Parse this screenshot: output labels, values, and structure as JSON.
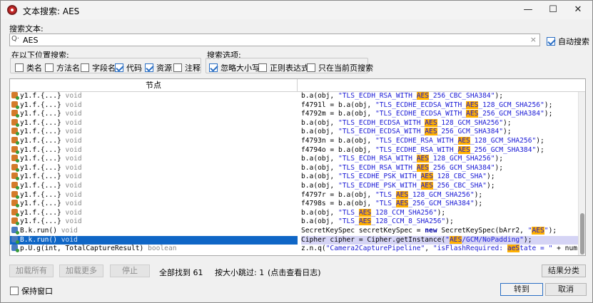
{
  "window": {
    "title": "文本搜索: AES",
    "minimize": "—",
    "maximize": "☐",
    "close": "✕"
  },
  "search": {
    "label": "搜索文本:",
    "value": "AES",
    "clear": "×",
    "auto_search": "自动搜索"
  },
  "location": {
    "label": "在以下位置搜索:",
    "options": [
      {
        "label": "类名",
        "checked": false
      },
      {
        "label": "方法名",
        "checked": false
      },
      {
        "label": "字段名",
        "checked": false
      },
      {
        "label": "代码",
        "checked": true
      },
      {
        "label": "资源",
        "checked": true
      },
      {
        "label": "注释",
        "checked": false
      }
    ]
  },
  "search_options": {
    "label": "搜索选项:",
    "options": [
      {
        "label": "忽略大小写",
        "checked": true
      },
      {
        "label": "正则表达式",
        "checked": false
      },
      {
        "label": "只在当前页搜索",
        "checked": false
      }
    ]
  },
  "table": {
    "header_node": "节点",
    "rows": [
      {
        "node": "y1.f.{...}",
        "type": "void",
        "code": "b.a(obj, \"TLS_ECDH_RSA_WITH_AES_256_CBC_SHA384\");"
      },
      {
        "node": "y1.f.{...}",
        "type": "void",
        "code": "f4791l = b.a(obj, \"TLS_ECDHE_ECDSA_WITH_AES_128_GCM_SHA256\");"
      },
      {
        "node": "y1.f.{...}",
        "type": "void",
        "code": "f4792m = b.a(obj, \"TLS_ECDHE_ECDSA_WITH_AES_256_GCM_SHA384\");"
      },
      {
        "node": "y1.f.{...}",
        "type": "void",
        "code": "b.a(obj, \"TLS_ECDH_ECDSA_WITH_AES_128_GCM_SHA256\");"
      },
      {
        "node": "y1.f.{...}",
        "type": "void",
        "code": "b.a(obj, \"TLS_ECDH_ECDSA_WITH_AES_256_GCM_SHA384\");"
      },
      {
        "node": "y1.f.{...}",
        "type": "void",
        "code": "f4793n = b.a(obj, \"TLS_ECDHE_RSA_WITH_AES_128_GCM_SHA256\");"
      },
      {
        "node": "y1.f.{...}",
        "type": "void",
        "code": "f4794o = b.a(obj, \"TLS_ECDHE_RSA_WITH_AES_256_GCM_SHA384\");"
      },
      {
        "node": "y1.f.{...}",
        "type": "void",
        "code": "b.a(obj, \"TLS_ECDH_RSA_WITH_AES_128_GCM_SHA256\");"
      },
      {
        "node": "y1.f.{...}",
        "type": "void",
        "code": "b.a(obj, \"TLS_ECDH_RSA_WITH_AES_256_GCM_SHA384\");"
      },
      {
        "node": "y1.f.{...}",
        "type": "void",
        "code": "b.a(obj, \"TLS_ECDHE_PSK_WITH_AES_128_CBC_SHA\");"
      },
      {
        "node": "y1.f.{...}",
        "type": "void",
        "code": "b.a(obj, \"TLS_ECDHE_PSK_WITH_AES_256_CBC_SHA\");"
      },
      {
        "node": "y1.f.{...}",
        "type": "void",
        "code": "f4797r = b.a(obj, \"TLS_AES_128_GCM_SHA256\");"
      },
      {
        "node": "y1.f.{...}",
        "type": "void",
        "code": "f4798s = b.a(obj, \"TLS_AES_256_GCM_SHA384\");"
      },
      {
        "node": "y1.f.{...}",
        "type": "void",
        "code": "b.a(obj, \"TLS_AES_128_CCM_SHA256\");"
      },
      {
        "node": "y1.f.{...}",
        "type": "void",
        "code": "b.a(obj, \"TLS_AES_128_CCM_8_SHA256\");"
      },
      {
        "node": "B.k.run()",
        "type": "void",
        "code": "SecretKeySpec secretKeySpec = new SecretKeySpec(bArr2, \"AES\");"
      },
      {
        "node": "B.k.run()",
        "type": "void",
        "code": "Cipher cipher = Cipher.getInstance(\"AES/GCM/NoPadding\");",
        "selected": true
      },
      {
        "node": "p.U.g(int, TotalCaptureResult)",
        "type": "boolean",
        "code": "z.n.q(\"Camera2CapturePipeline\", \"isFlashRequired: aeState = \" + num);"
      }
    ]
  },
  "footer": {
    "load_all": "加载所有",
    "load_more": "加载更多",
    "stop": "停止",
    "found": "全部找到 61",
    "skipped": "按大小跳过: 1",
    "log_hint": "(点击查看日志)",
    "group_results": "结果分类",
    "keep_window": "保持窗口",
    "goto": "转到",
    "cancel": "取消"
  },
  "colors": {
    "highlight": "#ffb000",
    "selection": "#0f66c6",
    "accent": "#2b6fc4"
  }
}
